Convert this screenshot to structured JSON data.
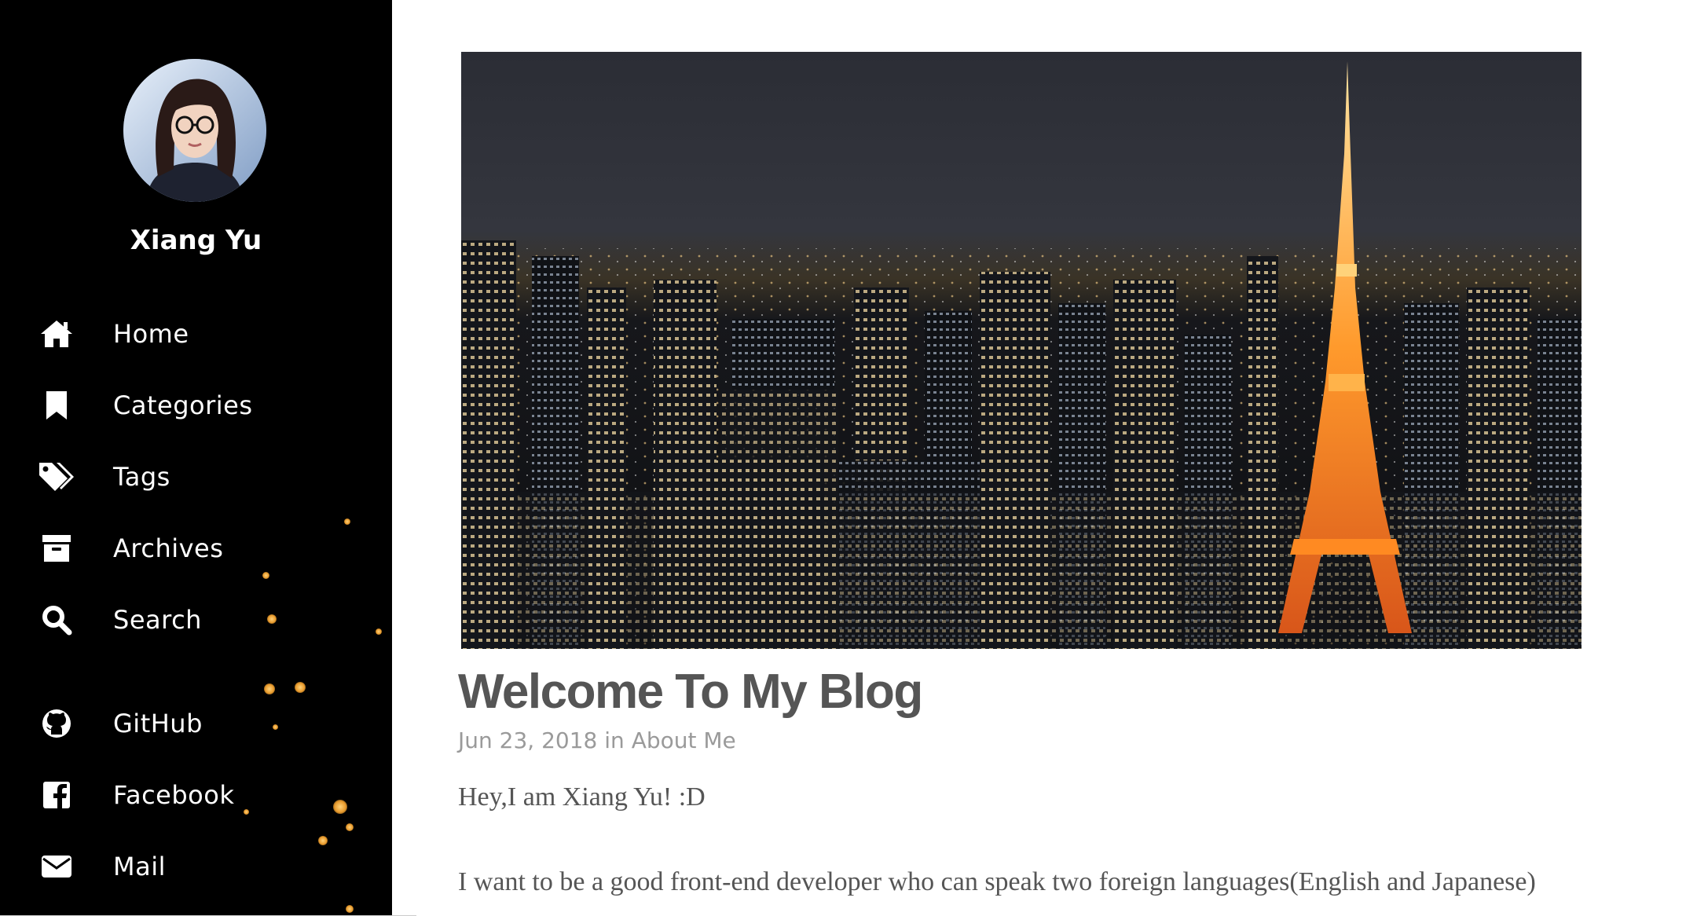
{
  "sidebar": {
    "author_name": "Xiang Yu",
    "nav": [
      {
        "label": "Home",
        "icon": "home-icon"
      },
      {
        "label": "Categories",
        "icon": "bookmark-icon"
      },
      {
        "label": "Tags",
        "icon": "tags-icon"
      },
      {
        "label": "Archives",
        "icon": "archive-icon"
      },
      {
        "label": "Search",
        "icon": "search-icon"
      }
    ],
    "social": [
      {
        "label": "GitHub",
        "icon": "github-icon"
      },
      {
        "label": "Facebook",
        "icon": "facebook-icon"
      },
      {
        "label": "Mail",
        "icon": "mail-icon"
      }
    ]
  },
  "post": {
    "title": "Welcome To My Blog",
    "date": "Jun 23, 2018",
    "in_word": "in",
    "category": "About Me",
    "paragraphs": [
      "Hey,I am Xiang Yu! :D",
      "I want to be a good front-end developer who can speak two foreign languages(English and Japanese)"
    ]
  },
  "colors": {
    "sidebar_bg": "#000000",
    "title": "#555555",
    "meta": "#9a9a9a"
  }
}
